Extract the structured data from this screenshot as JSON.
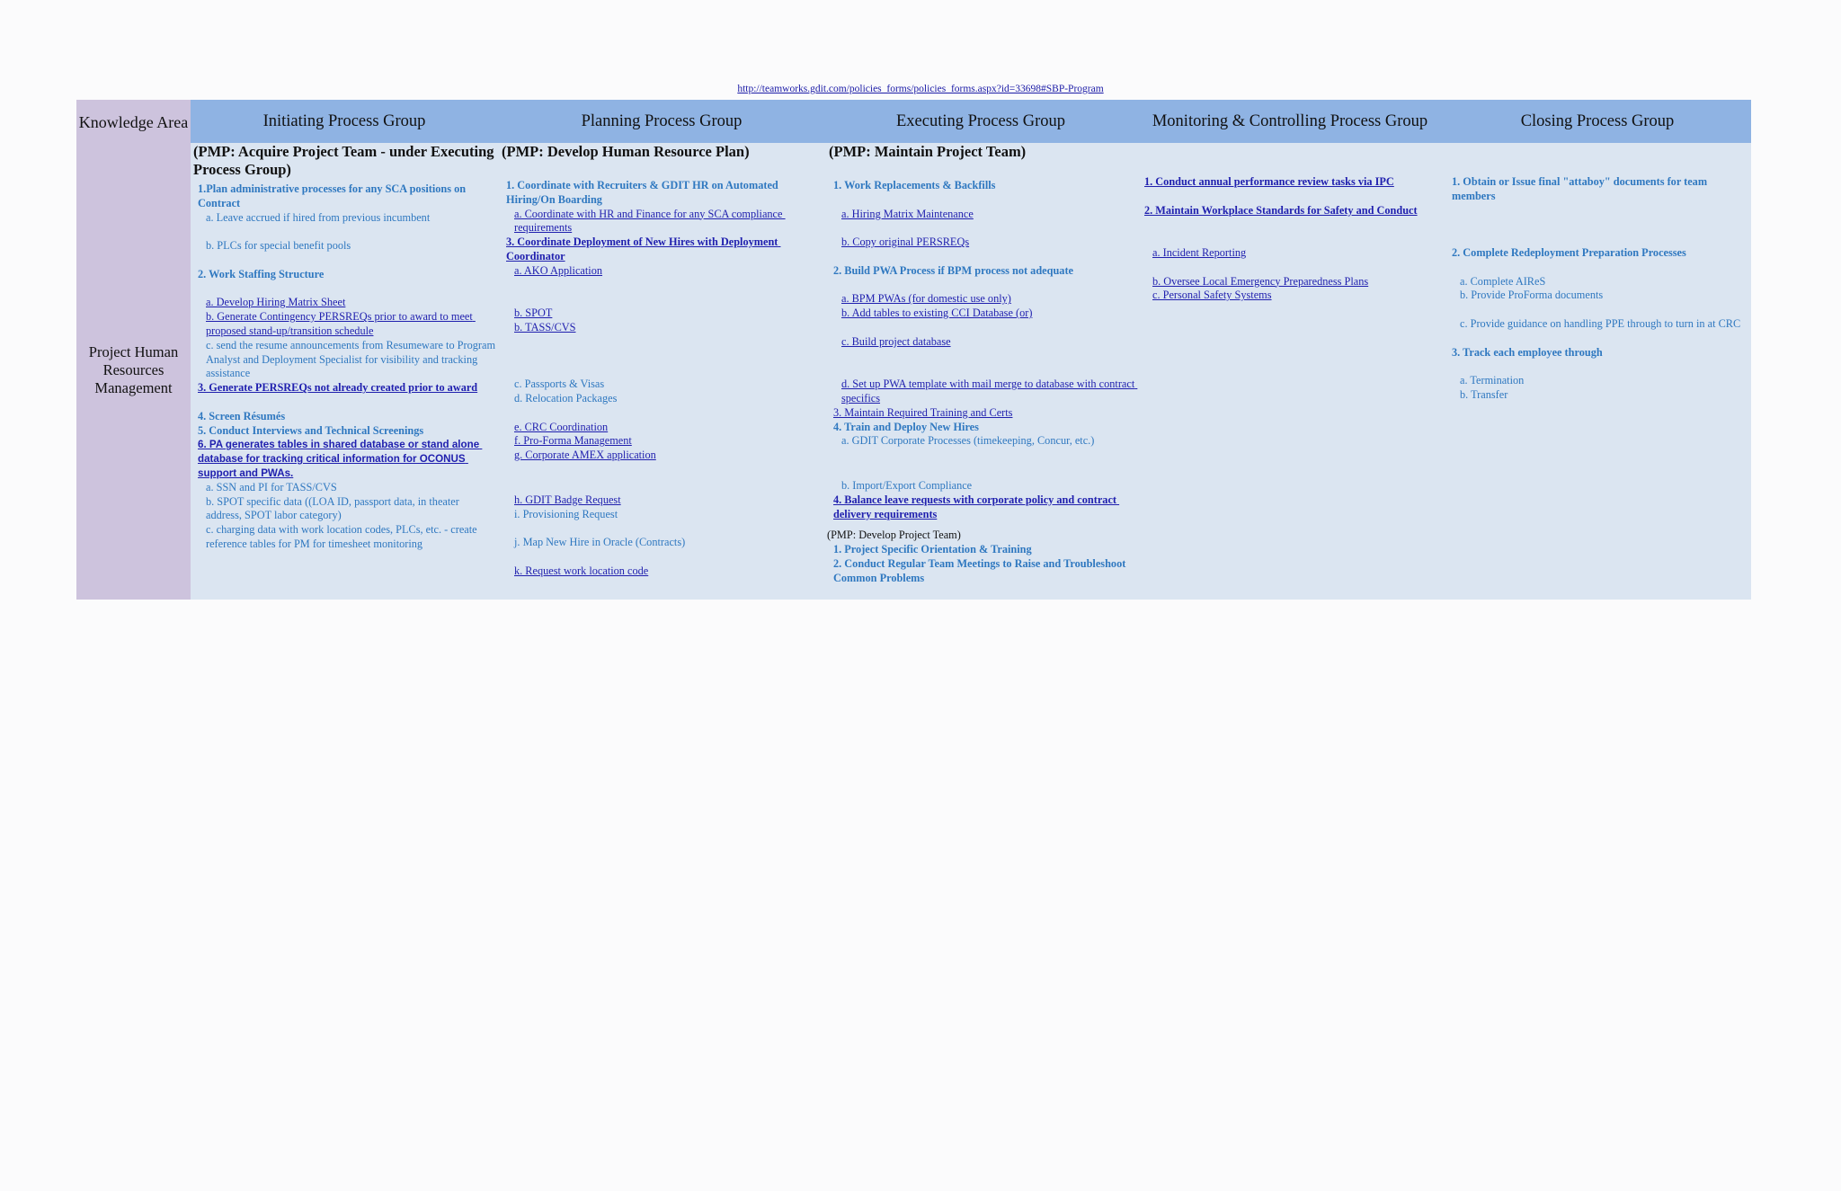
{
  "url": "http://teamworks.gdit.com/policies_forms/policies_forms.aspx?id=33698#SBP-Program",
  "knowledge_area_header": "Knowledge Area",
  "knowledge_area_name": "Project Human Resources Management",
  "headers": {
    "initiating": "Initiating Process Group",
    "planning": "Planning Process Group",
    "executing": "Executing Process Group",
    "monitoring": "Monitoring & Controlling Process Group",
    "closing": "Closing Process Group"
  },
  "initiating": {
    "title": "(PMP: Acquire Project Team - under Executing Process Group)",
    "items": [
      "1.Plan administrative processes for any SCA positions on Contract",
      "a. Leave accrued if hired from previous incumbent",
      "b. PLCs for special benefit pools",
      "2. Work Staffing Structure",
      "a. Develop Hiring Matrix Sheet",
      "b. Generate Contingency PERSREQs prior to award to meet proposed stand-up/transition schedule",
      "c. send the resume announcements from Resumeware to Program Analyst and Deployment Specialist for visibility and tracking assistance",
      "3. Generate PERSREQs not already created prior to award",
      "4. Screen Résumés",
      "5. Conduct Interviews and Technical Screenings",
      "6. PA generates tables in shared database or stand alone database for tracking critical information for OCONUS support and PWAs.",
      "a. SSN and PI for TASS/CVS",
      "b. SPOT specific data ((LOA ID, passport data, in theater address, SPOT labor category)",
      "c. charging data with work location codes, PLCs, etc. - create reference tables for PM for timesheet monitoring"
    ]
  },
  "planning": {
    "title": "(PMP: Develop Human Resource Plan)",
    "items": [
      "1. Coordinate with Recruiters & GDIT HR on Automated Hiring/On Boarding",
      "a. Coordinate with HR and Finance for any SCA compliance requirements",
      "3. Coordinate Deployment of New Hires with Deployment Coordinator",
      "a. AKO Application",
      "b. SPOT",
      "b. TASS/CVS",
      "c. Passports & Visas",
      "d. Relocation Packages",
      "e. CRC Coordination",
      "f. Pro-Forma Management",
      "g. Corporate AMEX application",
      "h. GDIT Badge Request",
      "i. Provisioning Request",
      "j. Map New Hire in Oracle (Contracts)",
      "k. Request work location code"
    ]
  },
  "executing": {
    "title": "(PMP: Maintain Project Team)",
    "items": [
      "1. Work Replacements & Backfills",
      "a. Hiring Matrix Maintenance",
      "b. Copy original PERSREQs",
      "2. Build PWA Process if BPM process not adequate",
      "a. BPM PWAs (for domestic use only)",
      "b. Add tables to existing CCI Database (or)",
      "c. Build project database",
      "d. Set up PWA template with mail merge to database with contract specifics",
      "3. Maintain Required Training and Certs",
      "4. Train and Deploy New Hires",
      "a. GDIT Corporate Processes (timekeeping, Concur, etc.)",
      "b. Import/Export Compliance",
      "4. Balance leave requests with corporate policy and contract delivery requirements",
      "(PMP: Develop Project Team)",
      "1. Project Specific Orientation & Training",
      "2. Conduct Regular Team Meetings to Raise and Troubleshoot Common Problems"
    ]
  },
  "monitoring": {
    "items": [
      "1. Conduct annual performance review tasks via IPC",
      "2. Maintain Workplace Standards for Safety and Conduct",
      "a. Incident Reporting",
      "b. Oversee Local Emergency Preparedness Plans",
      "c. Personal Safety Systems"
    ]
  },
  "closing": {
    "items": [
      "1. Obtain or Issue final \"attaboy\" documents for team members",
      "2. Complete Redeployment Preparation Processes",
      "a. Complete AIReS",
      "b. Provide ProForma documents",
      "c. Provide guidance on handling PPE through to turn in at CRC",
      "3. Track each employee through",
      "a. Termination",
      "b. Transfer"
    ]
  },
  "colors": {
    "header_band": "#8fb3e3",
    "body_band": "#dbe5f1",
    "knowledge_area_band": "#cdc3dd",
    "item_blue": "#2f78c0",
    "link_blue": "#1f1fae"
  }
}
